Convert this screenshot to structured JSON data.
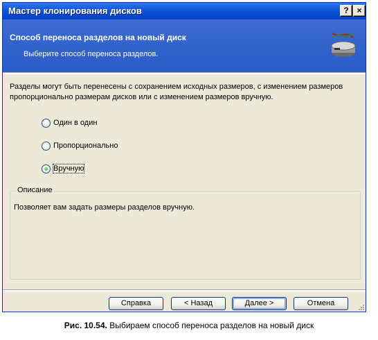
{
  "window": {
    "title": "Мастер клонирования дисков",
    "help_glyph": "?",
    "close_glyph": "×"
  },
  "header": {
    "title": "Способ переноса разделов на новый диск",
    "subtitle": "Выберите способ переноса разделов.",
    "icon": "disk-clone-icon"
  },
  "intro": "Разделы могут быть перенесены с сохранением исходных размеров, с изменением размеров пропорционально размерам дисков или с изменением размеров вручную.",
  "options": [
    {
      "label": "Один в один",
      "checked": false
    },
    {
      "label": "Пропорционально",
      "checked": false
    },
    {
      "label": "Вручную",
      "checked": true
    }
  ],
  "description": {
    "title": "Описание",
    "text": "Позволяет вам задать размеры разделов вручную."
  },
  "buttons": {
    "help": "Справка",
    "back": "< Назад",
    "next": "Далее >",
    "cancel": "Отмена"
  },
  "caption": {
    "label": "Рис. 10.54.",
    "text": " Выбираем способ переноса разделов на новый диск"
  },
  "colors": {
    "titlebar": "#0a4ad0",
    "header": "#2f62cb",
    "dialog": "#ece9d8",
    "radio_selected": "#21a121"
  }
}
